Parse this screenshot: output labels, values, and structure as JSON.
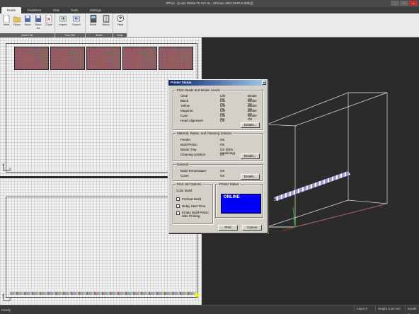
{
  "window": {
    "title": "ZPrint - [Color Media 70 mm 3x - ZPrinter 650 (SERIAL0093)]",
    "min": "_",
    "max": "□",
    "close": "x"
  },
  "tabs": [
    "Home",
    "Transform",
    "View",
    "Tools",
    "Settings"
  ],
  "ribbon": {
    "groups": [
      {
        "label": "Build File",
        "buttons": [
          {
            "label": "New",
            "icon": "new-file-icon"
          },
          {
            "label": "Open",
            "icon": "open-folder-icon"
          },
          {
            "label": "Save",
            "icon": "save-icon"
          },
          {
            "label": "Save As",
            "icon": "save-as-icon"
          },
          {
            "label": "Close",
            "icon": "close-file-icon"
          }
        ]
      },
      {
        "label": "Part File",
        "buttons": [
          {
            "label": "Import",
            "icon": "import-icon"
          },
          {
            "label": "Export",
            "icon": "export-icon"
          }
        ]
      },
      {
        "label": "Build",
        "buttons": [
          {
            "label": "Build",
            "icon": "build-icon"
          },
          {
            "label": "Setup",
            "icon": "setup-icon"
          }
        ]
      },
      {
        "label": "Help",
        "buttons": [
          {
            "label": "Help",
            "icon": "help-icon"
          }
        ]
      }
    ]
  },
  "dialog": {
    "title": "Printer Status",
    "heads": {
      "title": "Print Heads and Binder Levels",
      "rows": [
        {
          "name": "Clear",
          "life": "Life OK",
          "binder": "Binder OK"
        },
        {
          "name": "Black",
          "life": "Life OK",
          "binder": "Binder OK"
        },
        {
          "name": "Yellow",
          "life": "Life OK",
          "binder": "Binder OK"
        },
        {
          "name": "Magenta",
          "life": "Life OK",
          "binder": "Binder OK"
        },
        {
          "name": "Cyan",
          "life": "Life OK",
          "binder": "Binder OK"
        },
        {
          "name": "Head Alignment",
          "life": "OK",
          "binder": ""
        }
      ],
      "details": "Details..."
    },
    "material": {
      "title": "Material, Waste, and Cleaning Solution",
      "rows": [
        {
          "name": "Feeder",
          "value": "OK"
        },
        {
          "name": "Build Piston",
          "value": "OK"
        },
        {
          "name": "Waste Tray",
          "value": "OK  (93% remaining)"
        },
        {
          "name": "Cleaning Solution",
          "value": "OK"
        }
      ],
      "details": "Details..."
    },
    "general": {
      "title": "General",
      "rows": [
        {
          "name": "Build Temperature",
          "value": "OK"
        },
        {
          "name": "Cover",
          "value": "OK"
        }
      ],
      "details": "Details..."
    },
    "options": {
      "title": "Print Job Options",
      "color_build": "Color Build",
      "checks": [
        "Preheat Build",
        "Delay Start Time",
        "Empty Build Piston after Printing"
      ]
    },
    "status": {
      "title": "Printer Status",
      "value": "ONLINE"
    },
    "print": "Print",
    "cancel": "Cancel"
  },
  "statusbar": {
    "ready": "Ready",
    "layer": "Layer 0",
    "height": "Height 0.00 mm",
    "model": "Model C"
  }
}
